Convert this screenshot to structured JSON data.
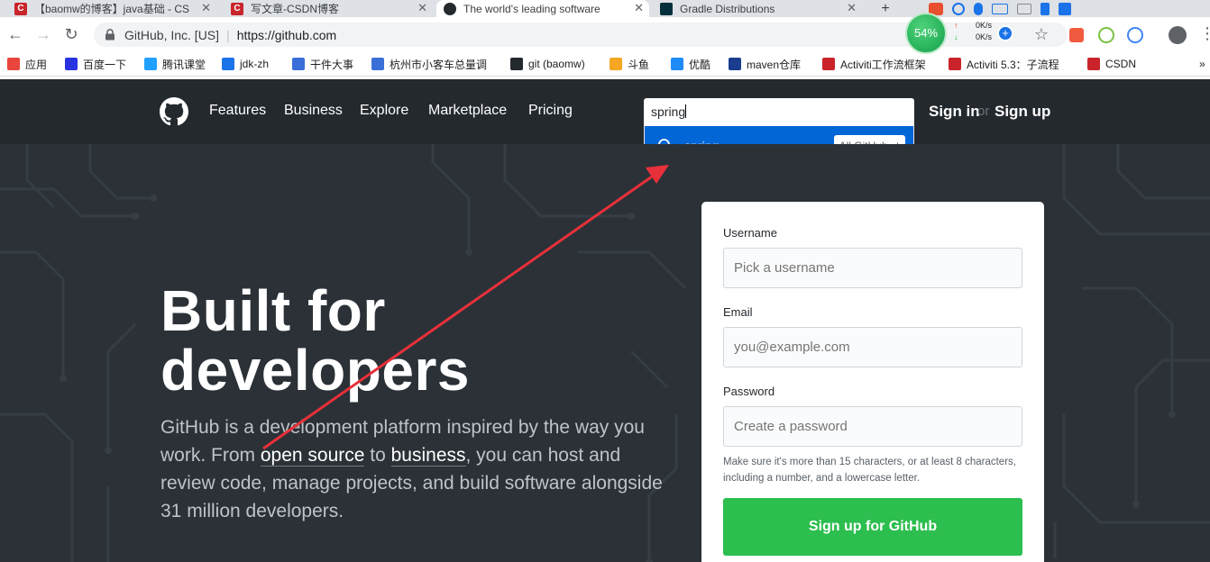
{
  "browser": {
    "tabs": [
      {
        "title": "【baomw的博客】java基础 - CS",
        "favicon": "C"
      },
      {
        "title": "写文章-CSDN博客",
        "favicon": "C"
      },
      {
        "title": "The world's leading software",
        "favicon": "gh"
      },
      {
        "title": "Gradle Distributions",
        "favicon": "gradle"
      }
    ],
    "url_org": "GitHub, Inc. [US]",
    "url": "https://github.com",
    "ext_percent": "54%",
    "net_up": "0K/s",
    "net_down": "0K/s",
    "bookmarks": [
      {
        "label": "应用",
        "icon": "apps-icon",
        "color": "#e8453c"
      },
      {
        "label": "百度一下",
        "icon": "baidu-icon",
        "color": "#2932e1"
      },
      {
        "label": "腾讯课堂",
        "icon": "tencent-icon",
        "color": "#20a0ff"
      },
      {
        "label": "jdk-zh",
        "icon": "c-icon",
        "color": "#1a73e8"
      },
      {
        "label": "干件大事",
        "icon": "dots-icon",
        "color": "#3b6fd8"
      },
      {
        "label": "杭州市小客车总量调",
        "icon": "dots-icon",
        "color": "#3b6fd8"
      },
      {
        "label": "git (baomw)",
        "icon": "github-icon",
        "color": "#24292e"
      },
      {
        "label": "斗鱼",
        "icon": "douyu-icon",
        "color": "#f5a623"
      },
      {
        "label": "优酷",
        "icon": "youku-icon",
        "color": "#1f8bf6"
      },
      {
        "label": "maven仓库",
        "icon": "mvn-icon",
        "color": "#1b3d8f"
      },
      {
        "label": "Activiti工作流框架",
        "icon": "csdn-icon",
        "color": "#c9242b"
      },
      {
        "label": "Activiti 5.3：子流程",
        "icon": "csdn-icon",
        "color": "#c9242b"
      },
      {
        "label": "CSDN",
        "icon": "csdn-icon",
        "color": "#c9242b"
      }
    ],
    "bookmarks_more": "»"
  },
  "header": {
    "nav": [
      "Features",
      "Business",
      "Explore",
      "Marketplace",
      "Pricing"
    ],
    "search_value": "spring",
    "suggestion": "spring",
    "suggestion_scope": "All GitHub ↵",
    "sign_in": "Sign in",
    "or": "or",
    "sign_up": "Sign up"
  },
  "hero": {
    "headline_line1": "Built for",
    "headline_line2": "developers",
    "sub_1": "GitHub is a development platform inspired by the way you work. From ",
    "sub_link1": "open source",
    "sub_2": " to ",
    "sub_link2": "business",
    "sub_3": ", you can host and review code, manage projects, and build software alongside 31 million developers."
  },
  "form": {
    "username_label": "Username",
    "username_placeholder": "Pick a username",
    "email_label": "Email",
    "email_placeholder": "you@example.com",
    "password_label": "Password",
    "password_placeholder": "Create a password",
    "hint": "Make sure it's more than 15 characters, or at least 8 characters, including a number, and a lowercase letter.",
    "submit": "Sign up for GitHub"
  },
  "colors": {
    "header_bg": "#24292e",
    "hero_bg": "#2b3137",
    "link_blue": "#0366d6",
    "signup_green": "#2cbe4e",
    "annotation_red": "#e8303a"
  }
}
